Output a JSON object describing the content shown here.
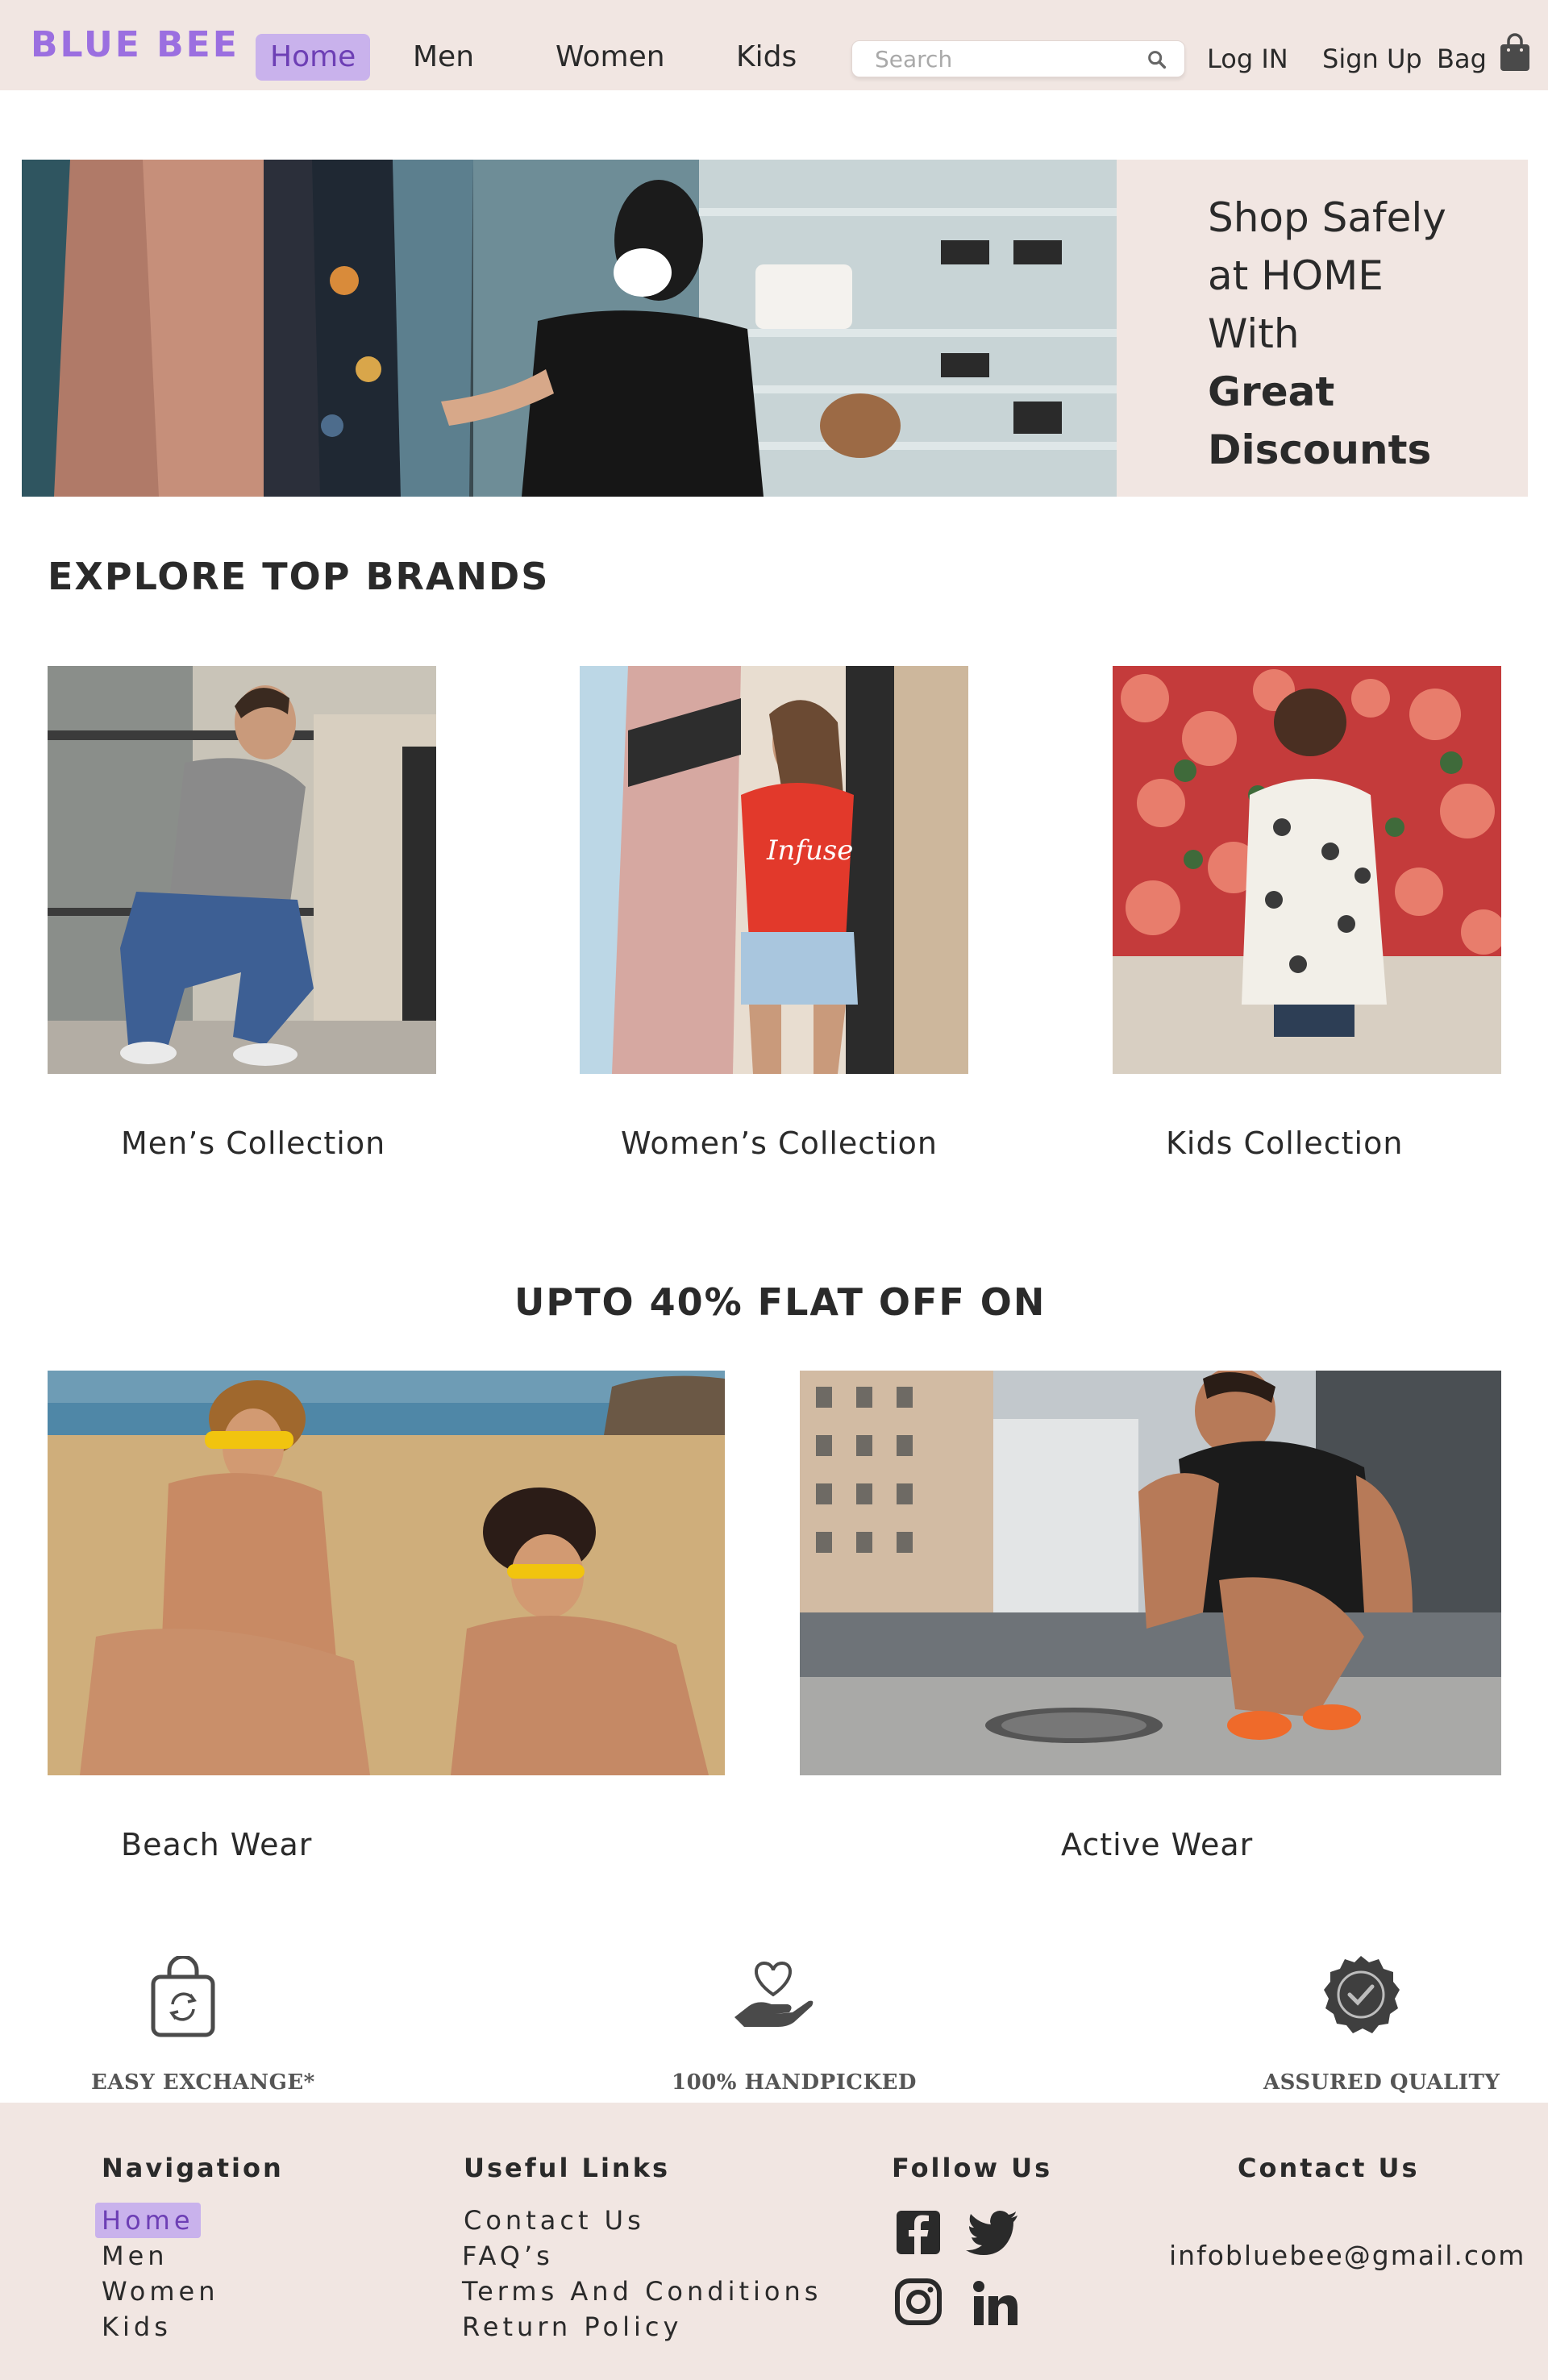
{
  "header": {
    "logo": "BLUE BEE",
    "nav": [
      "Home",
      "Men",
      "Women",
      "Kids"
    ],
    "search_placeholder": "Search",
    "login": "Log IN",
    "signup": "Sign Up",
    "bag": "Bag"
  },
  "hero": {
    "line1": "Shop Safely",
    "line2": "at HOME",
    "line3": "With",
    "line4": "Great",
    "line5": "Discounts"
  },
  "brands": {
    "title": "EXPLORE TOP BRANDS",
    "items": [
      {
        "label": "Men’s  Collection"
      },
      {
        "label": "Women’s  Collection"
      },
      {
        "label": "Kids  Collection"
      }
    ]
  },
  "offers": {
    "title": "UPTO 40% FLAT OFF ON",
    "items": [
      {
        "label": "Beach  Wear"
      },
      {
        "label": "Active  Wear"
      }
    ]
  },
  "features": [
    {
      "label": "EASY EXCHANGE*",
      "icon": "exchange-bag-icon"
    },
    {
      "label": "100% HANDPICKED",
      "icon": "hand-heart-icon"
    },
    {
      "label": "ASSURED QUALITY",
      "icon": "quality-badge-icon"
    }
  ],
  "footer": {
    "navigation_title": "Navigation",
    "navigation": [
      "Home",
      "Men",
      "Women",
      "Kids"
    ],
    "useful_title": "Useful  Links",
    "useful": [
      "Contact Us",
      "FAQ’s",
      "Terms And Conditions",
      "Return Policy"
    ],
    "follow_title": "Follow Us",
    "social_icons": [
      "facebook-icon",
      "twitter-icon",
      "instagram-icon",
      "linkedin-icon"
    ],
    "contact_title": "Contact Us",
    "email": "infobluebee@gmail.com"
  },
  "colors": {
    "accent": "#9b6fe0",
    "active_bg": "#c9b2ec",
    "panel_bg": "#f1e6e2"
  }
}
